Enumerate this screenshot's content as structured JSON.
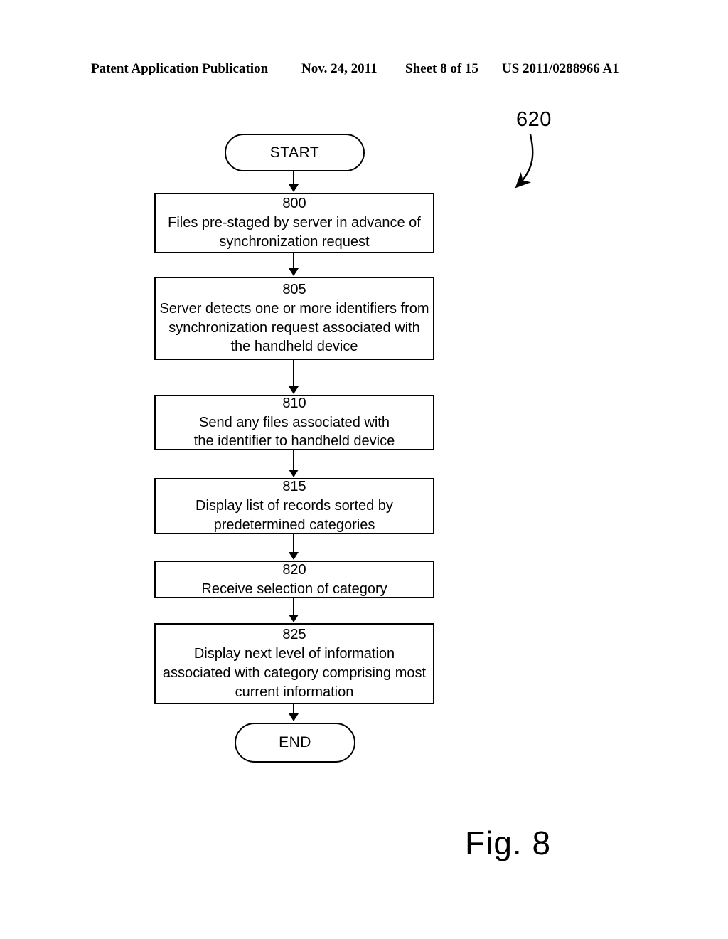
{
  "header": {
    "publication": "Patent Application Publication",
    "date": "Nov. 24, 2011",
    "sheet": "Sheet 8 of 15",
    "patent_number": "US 2011/0288966 A1"
  },
  "figure": {
    "caption": "Fig. 8",
    "reference_numeral": "620"
  },
  "flowchart": {
    "start": {
      "label": "START"
    },
    "end": {
      "label": "END"
    },
    "steps": [
      {
        "ref": "800",
        "text": "Files pre-staged by server in advance of\nsynchronization request"
      },
      {
        "ref": "805",
        "text": "Server detects one or more identifiers from\nsynchronization request associated with\nthe handheld device"
      },
      {
        "ref": "810",
        "text": "Send any files associated with\nthe identifier to handheld device"
      },
      {
        "ref": "815",
        "text": "Display list of records sorted by\npredetermined categories"
      },
      {
        "ref": "820",
        "text": "Receive selection of category"
      },
      {
        "ref": "825",
        "text": "Display next level of information\nassociated with category comprising most\ncurrent information"
      }
    ]
  },
  "colors": {
    "ink": "#000000",
    "page": "#ffffff"
  }
}
